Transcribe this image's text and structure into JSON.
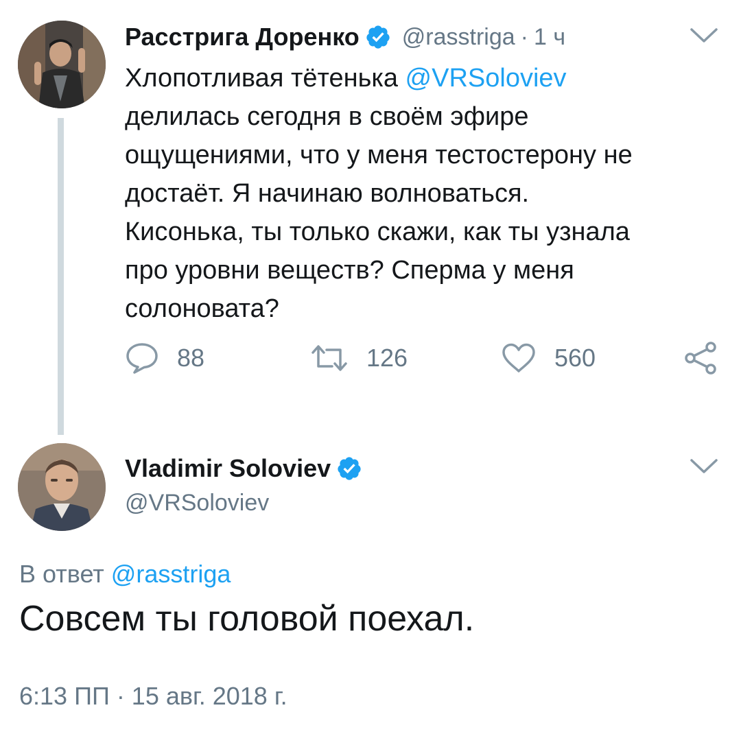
{
  "parent_tweet": {
    "display_name": "Расстрига Доренко",
    "handle": "@rasstriga",
    "separator": "·",
    "time": "1 ч",
    "text_lines": [
      {
        "before": "Хлопотливая тётенька ",
        "mention": "@VRSoloviev",
        "after": ""
      },
      {
        "before": "делилась сегодня в своём эфире",
        "mention": "",
        "after": ""
      },
      {
        "before": "ощущениями, что у меня тестостерону не",
        "mention": "",
        "after": ""
      },
      {
        "before": "достаёт. Я начинаю волноваться.",
        "mention": "",
        "after": ""
      },
      {
        "before": "Кисонька, ты только скажи, как ты узнала",
        "mention": "",
        "after": ""
      },
      {
        "before": "про уровни веществ? Сперма у меня",
        "mention": "",
        "after": ""
      },
      {
        "before": "солоновата?",
        "mention": "",
        "after": ""
      }
    ],
    "counts": {
      "replies": "88",
      "retweets": "126",
      "likes": "560"
    },
    "icons": {
      "reply": "reply-icon",
      "retweet": "retweet-icon",
      "like": "heart-icon",
      "share": "share-icon",
      "menu": "chevron-down-icon",
      "verified": "verified-badge-icon"
    }
  },
  "main_tweet": {
    "display_name": "Vladimir Soloviev",
    "handle": "@VRSoloviev",
    "reply_prefix": "В ответ ",
    "reply_to": "@rasstriga",
    "text": "Совсем ты головой поехал.",
    "timestamp": "6:13 ПП · 15 авг. 2018 г."
  },
  "colors": {
    "accent": "#1da1f2",
    "text": "#14171a",
    "secondary": "#657786",
    "thread_line": "#cfd9de"
  }
}
